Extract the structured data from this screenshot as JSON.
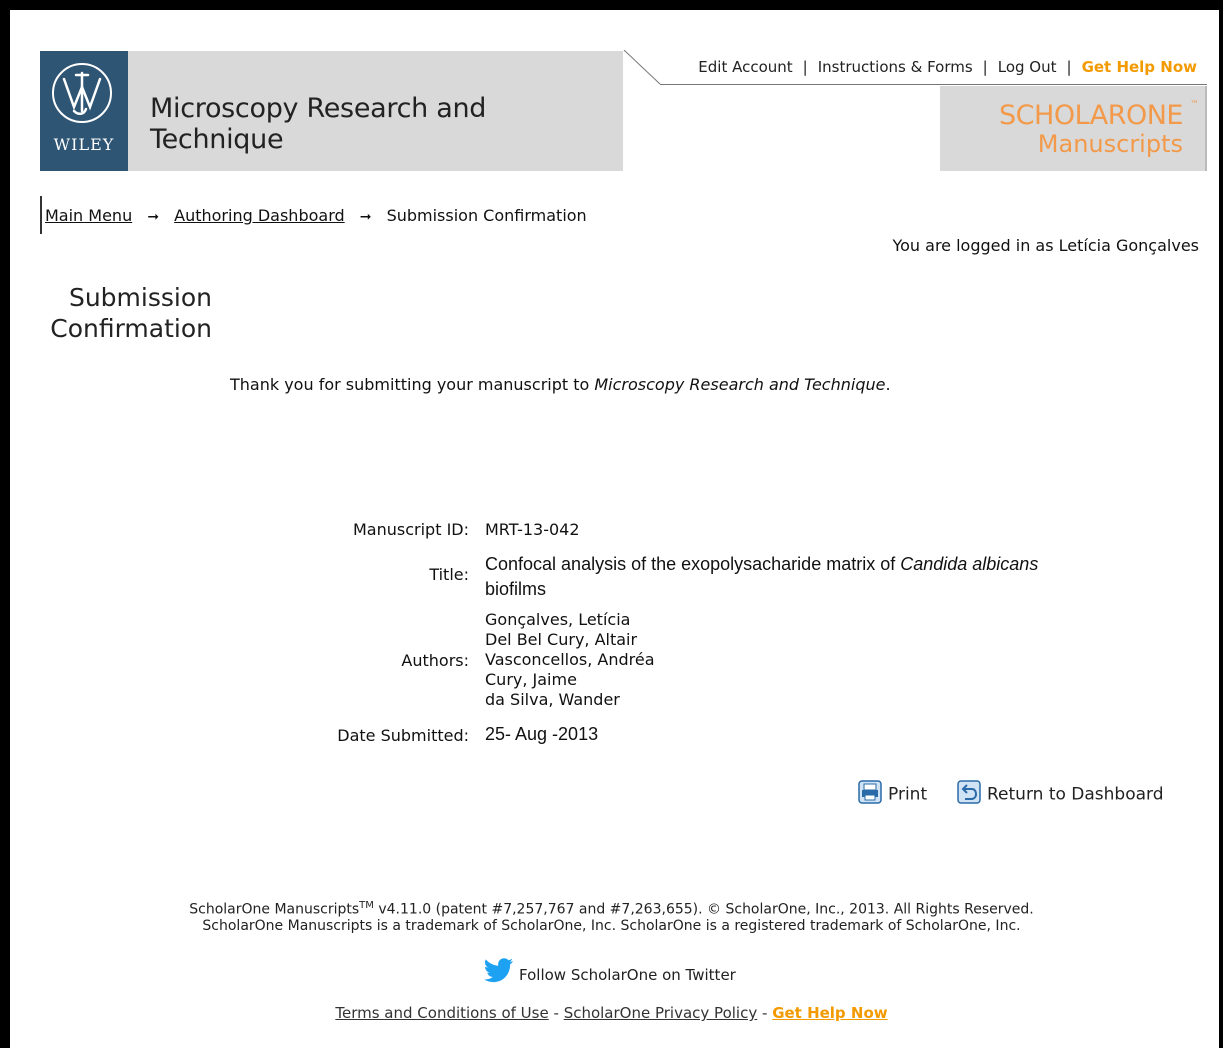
{
  "header": {
    "logo_text": "WILEY",
    "journal_title": "Microscopy Research and Technique",
    "top_links": {
      "edit_account": "Edit Account",
      "instructions": "Instructions & Forms",
      "log_out": "Log Out",
      "get_help": "Get Help Now",
      "separator": "|"
    },
    "brand_name": "SCHOLARONE",
    "brand_tm": "™",
    "brand_sub": "Manuscripts"
  },
  "breadcrumbs": {
    "main_menu": "Main Menu",
    "authoring_dashboard": "Authoring Dashboard",
    "current": "Submission Confirmation",
    "arrow": "➞"
  },
  "logged_in_text": "You are logged in as Letícia Gonçalves",
  "page_title_line1": "Submission",
  "page_title_line2": "Confirmation",
  "thanks": {
    "prefix": "Thank you for submitting your manuscript to ",
    "journal": "Microscopy Research and Technique",
    "suffix": "."
  },
  "details": {
    "manuscript_id_label": "Manuscript ID:",
    "manuscript_id": "MRT-13-042",
    "title_label": "Title:",
    "title_prefix": "Confocal analysis of the exopolysacharide matrix of ",
    "title_italic": "Candida albicans",
    "title_suffix": " biofilms",
    "authors_label": "Authors:",
    "authors": [
      "Gonçalves, Letícia",
      "Del Bel Cury, Altair",
      "Vasconcellos, Andréa",
      "Cury, Jaime",
      "da Silva, Wander"
    ],
    "date_label": "Date Submitted:",
    "date": "25- Aug -2013"
  },
  "buttons": {
    "print": "Print",
    "return": "Return to Dashboard"
  },
  "footer": {
    "line1_prefix": "ScholarOne Manuscripts",
    "line1_tm": "TM",
    "line1_suffix": " v4.11.0 (patent #7,257,767 and #7,263,655). © ScholarOne, Inc., 2013. All Rights Reserved.",
    "line2": "ScholarOne Manuscripts is a trademark of ScholarOne, Inc. ScholarOne is a registered trademark of ScholarOne, Inc.",
    "twitter": "Follow ScholarOne on Twitter",
    "terms": "Terms and Conditions of Use",
    "privacy": "ScholarOne Privacy Policy",
    "help": "Get Help Now",
    "dash": "-"
  },
  "colors": {
    "logo_bg": "#2f5575",
    "band_bg": "#d9d9d9",
    "brand_orange": "#f29a4a",
    "help_orange": "#f29a00",
    "twitter_blue": "#1da1f2"
  }
}
